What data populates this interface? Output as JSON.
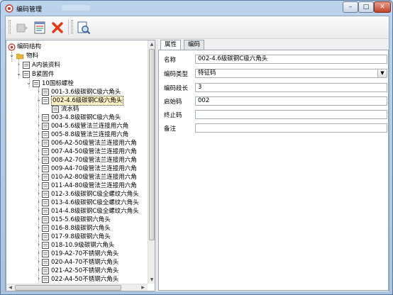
{
  "window": {
    "title": "编码管理",
    "controls": {
      "minimize": "–",
      "maximize": "□",
      "close": "✕"
    }
  },
  "toolbar": {
    "buttons": [
      {
        "name": "add",
        "icon": "add-icon",
        "enabled": false
      },
      {
        "name": "edit",
        "icon": "edit-icon",
        "enabled": true
      },
      {
        "name": "delete",
        "icon": "delete-icon",
        "enabled": true
      },
      {
        "name": "preview",
        "icon": "preview-icon",
        "enabled": true
      }
    ]
  },
  "tree": {
    "root": "编码结构",
    "level1": "物料",
    "level2": [
      "A内装资料",
      "B紧固件"
    ],
    "level3": "10国标螺栓",
    "selected": "002-4.6级碳钢C级六角头",
    "child_of_selected": "流水码",
    "items": [
      "001-3.6级碳钢C级六角头",
      "002-4.6级碳钢C级六角头",
      "003-4.8级碳钢C级六角头",
      "004-5.6级管法兰连接用六角",
      "005-8.8级管法兰连接用六角",
      "006-A2-50级管法兰连接用六角",
      "007-A4-50级管法兰连接用六角",
      "008-A2-70级管法兰连接用六角",
      "009-A4-70级管法兰连接用六角",
      "010-A2-80级管法兰连接用六角",
      "011-A4-80级管法兰连接用六角",
      "012-3.6级碳钢C级全螺纹六角头",
      "013-4.6级碳钢C级全螺纹六角头",
      "014-4.8级碳钢C级全螺纹六角头",
      "015-5.6级碳钢六角头",
      "016-8.8级碳钢六角头",
      "017-9.8级碳钢六角头",
      "018-10.9级碳钢六角头",
      "019-A2-70不锈钢六角头",
      "020-A4-70不锈钢六角头",
      "021-A2-50不锈钢六角头",
      "022-A4-50不锈钢六角头"
    ]
  },
  "tabs": [
    {
      "label": "属性",
      "active": true
    },
    {
      "label": "编码",
      "active": false
    }
  ],
  "form": {
    "name_label": "名称",
    "name_value": "002-4.6级碳钢C级六角头",
    "type_label": "编码类型",
    "type_value": "特征码",
    "length_label": "编码段长",
    "length_value": "3",
    "start_label": "启始码",
    "start_value": "002",
    "end_label": "终止码",
    "end_value": "",
    "note_label": "备注",
    "note_value": ""
  },
  "colors": {
    "selection": "#fff2c6",
    "folder": "#e8b33a",
    "delete": "#e03a16"
  }
}
